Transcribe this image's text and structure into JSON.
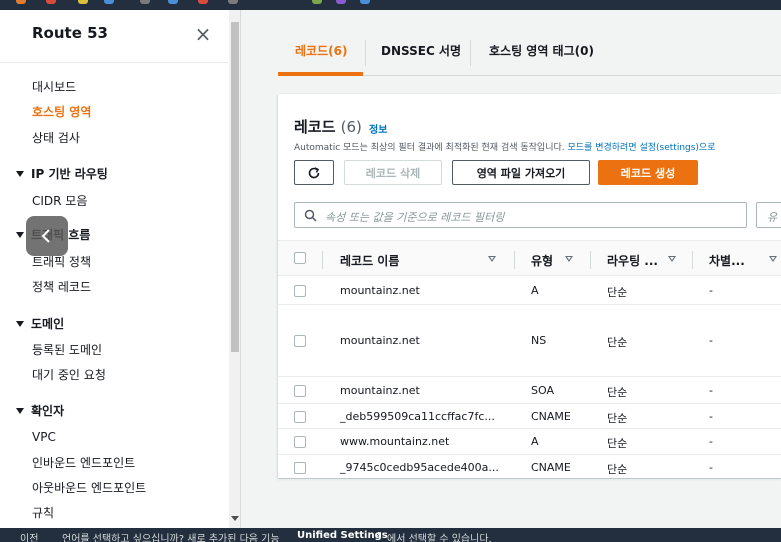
{
  "sidebar": {
    "title": "Route 53",
    "links_top": [
      "대시보드",
      "호스팅 영역",
      "상태 검사"
    ],
    "section_ip": {
      "heading": "IP 기반 라우팅",
      "items": [
        "CIDR 모음"
      ]
    },
    "section_traffic": {
      "heading": "트래픽 흐름",
      "items": [
        "트래픽 정책",
        "정책 레코드"
      ]
    },
    "section_domain": {
      "heading": "도메인",
      "items": [
        "등록된 도메인",
        "대기 중인 요청"
      ]
    },
    "section_resolver": {
      "heading": "확인자",
      "items": [
        "VPC",
        "인바운드 엔드포인트",
        "아웃바운드 엔드포인트",
        "규칙"
      ]
    }
  },
  "tabs": [
    "레코드(6)",
    "DNSSEC 서명",
    "호스팅 영역 태그(0)"
  ],
  "panel": {
    "title": "레코드",
    "count": "(6)",
    "info": "정보",
    "desc_text": "Automatic 모드는 최상의 필터 결과에 최적화된 현재 검색 동작입니다. ",
    "desc_link": "모드를 변경하려면 설정(settings)으로",
    "btn_delete": "레코드 삭제",
    "btn_import": "영역 파일 가져오기",
    "btn_create": "레코드 생성",
    "search_placeholder": "속성 또는 값을 기준으로 레코드 필터링",
    "search2_placeholder": "유"
  },
  "table": {
    "headers": [
      "레코드 이름",
      "유형",
      "라우팅 ...",
      "차별..."
    ],
    "rows": [
      {
        "name": "mountainz.net",
        "type": "A",
        "routing": "단순",
        "diff": "-"
      },
      {
        "name": "mountainz.net",
        "type": "NS",
        "routing": "단순",
        "diff": "-"
      },
      {
        "name": "mountainz.net",
        "type": "SOA",
        "routing": "단순",
        "diff": "-"
      },
      {
        "name": "_deb599509ca11ccffac7fc...",
        "type": "CNAME",
        "routing": "단순",
        "diff": "-"
      },
      {
        "name": "www.mountainz.net",
        "type": "A",
        "routing": "단순",
        "diff": "-"
      },
      {
        "name": "_9745c0cedb95acede400a...",
        "type": "CNAME",
        "routing": "단순",
        "diff": "-"
      }
    ]
  },
  "bottombar": {
    "left": "이전",
    "text": "언어를 선택하고 싶으십니까? 새로 추가된 다음 기능",
    "link": "Unified Settings",
    "after": "에서 선택할 수 있습니다."
  },
  "colors": {
    "accent": "#ec7211",
    "link": "#0073bb",
    "nav": "#232f3e"
  }
}
